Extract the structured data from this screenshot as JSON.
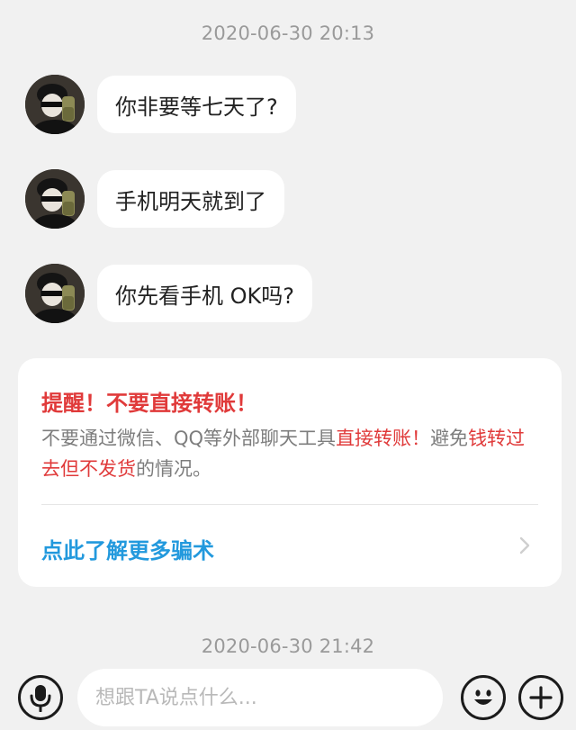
{
  "chat": {
    "timestamp_1": "2020-06-30 20:13",
    "timestamp_2": "2020-06-30 21:42",
    "messages": [
      {
        "text": "你非要等七天了?"
      },
      {
        "text": "手机明天就到了"
      },
      {
        "text": "你先看手机 OK吗?"
      }
    ]
  },
  "warning": {
    "title": "提醒！不要直接转账！",
    "body_part1": "不要通过微信、QQ等外部聊天工具",
    "body_red1": "直接转账！",
    "body_part2": "避免",
    "body_red2": "钱转过去但不发货",
    "body_part3": "的情况。",
    "link_label": "点此了解更多骗术"
  },
  "input": {
    "placeholder": "想跟TA说点什么..."
  },
  "icons": {
    "voice": "microphone-icon",
    "emoji": "smiley-icon",
    "more": "plus-icon",
    "chevron": "chevron-right-icon"
  },
  "colors": {
    "warning_red": "#e03a3a",
    "link_blue": "#2299dd",
    "background": "#f1f1f1"
  }
}
